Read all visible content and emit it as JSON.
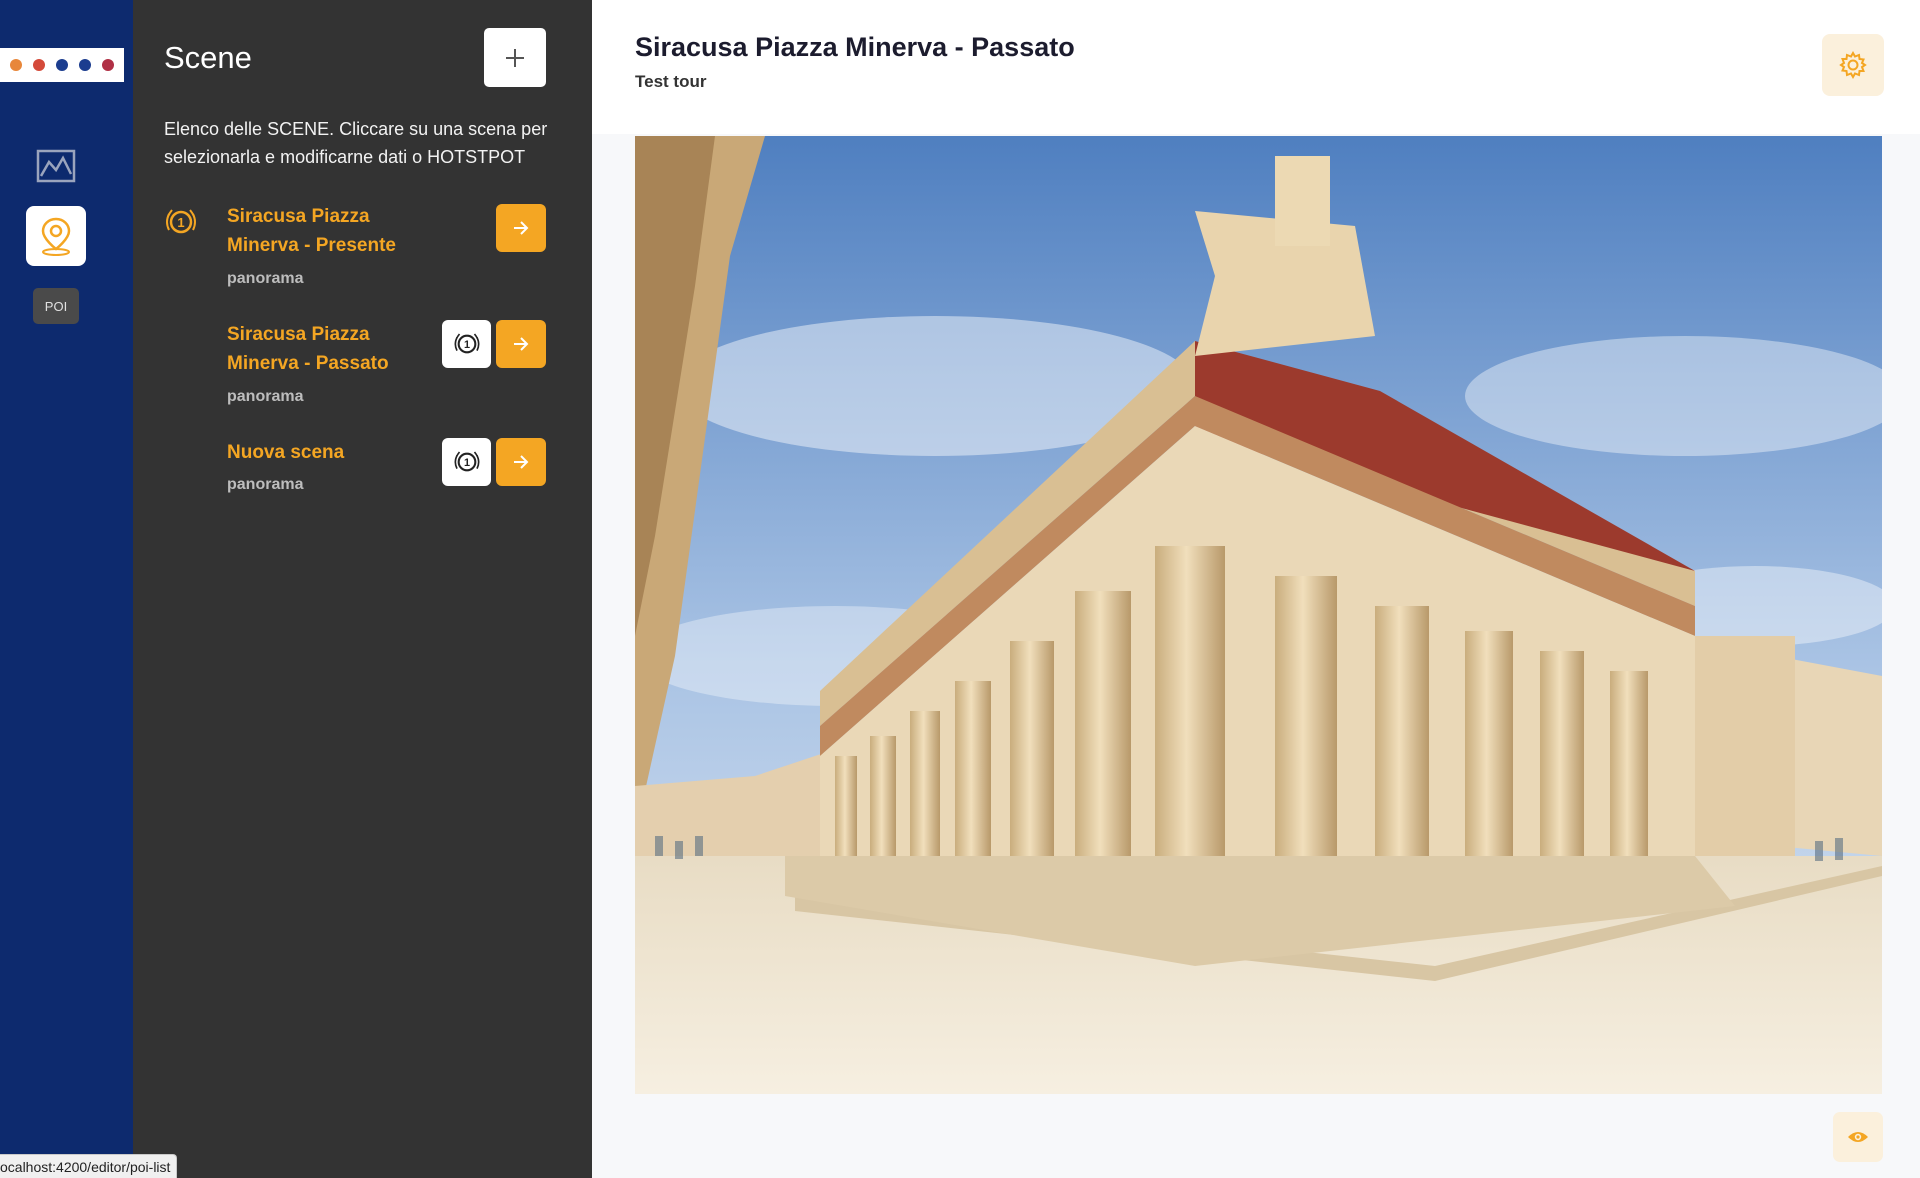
{
  "nav": {
    "icons": [
      "image-gallery-icon",
      "map-pin-icon"
    ],
    "poi_label": "POI"
  },
  "panel": {
    "title": "Scene",
    "description": "Elenco delle SCENE. Cliccare su una scena per selezionarla e modificarne dati o HOTSTPOT",
    "scenes": [
      {
        "name": "Siracusa Piazza Minerva - Presente",
        "type": "panorama",
        "is_first": true
      },
      {
        "name": "Siracusa Piazza Minerva - Passato",
        "type": "panorama",
        "is_first": false
      },
      {
        "name": "Nuova scena",
        "type": "panorama",
        "is_first": false
      }
    ]
  },
  "main": {
    "title": "Siracusa Piazza Minerva - Passato",
    "subtitle": "Test tour"
  },
  "status": {
    "url": "ocalhost:4200/editor/poi-list"
  },
  "colors": {
    "nav_bg": "#0d2a6e",
    "panel_bg": "#333333",
    "accent": "#f4a623",
    "accent_soft": "#fbf0dc"
  }
}
